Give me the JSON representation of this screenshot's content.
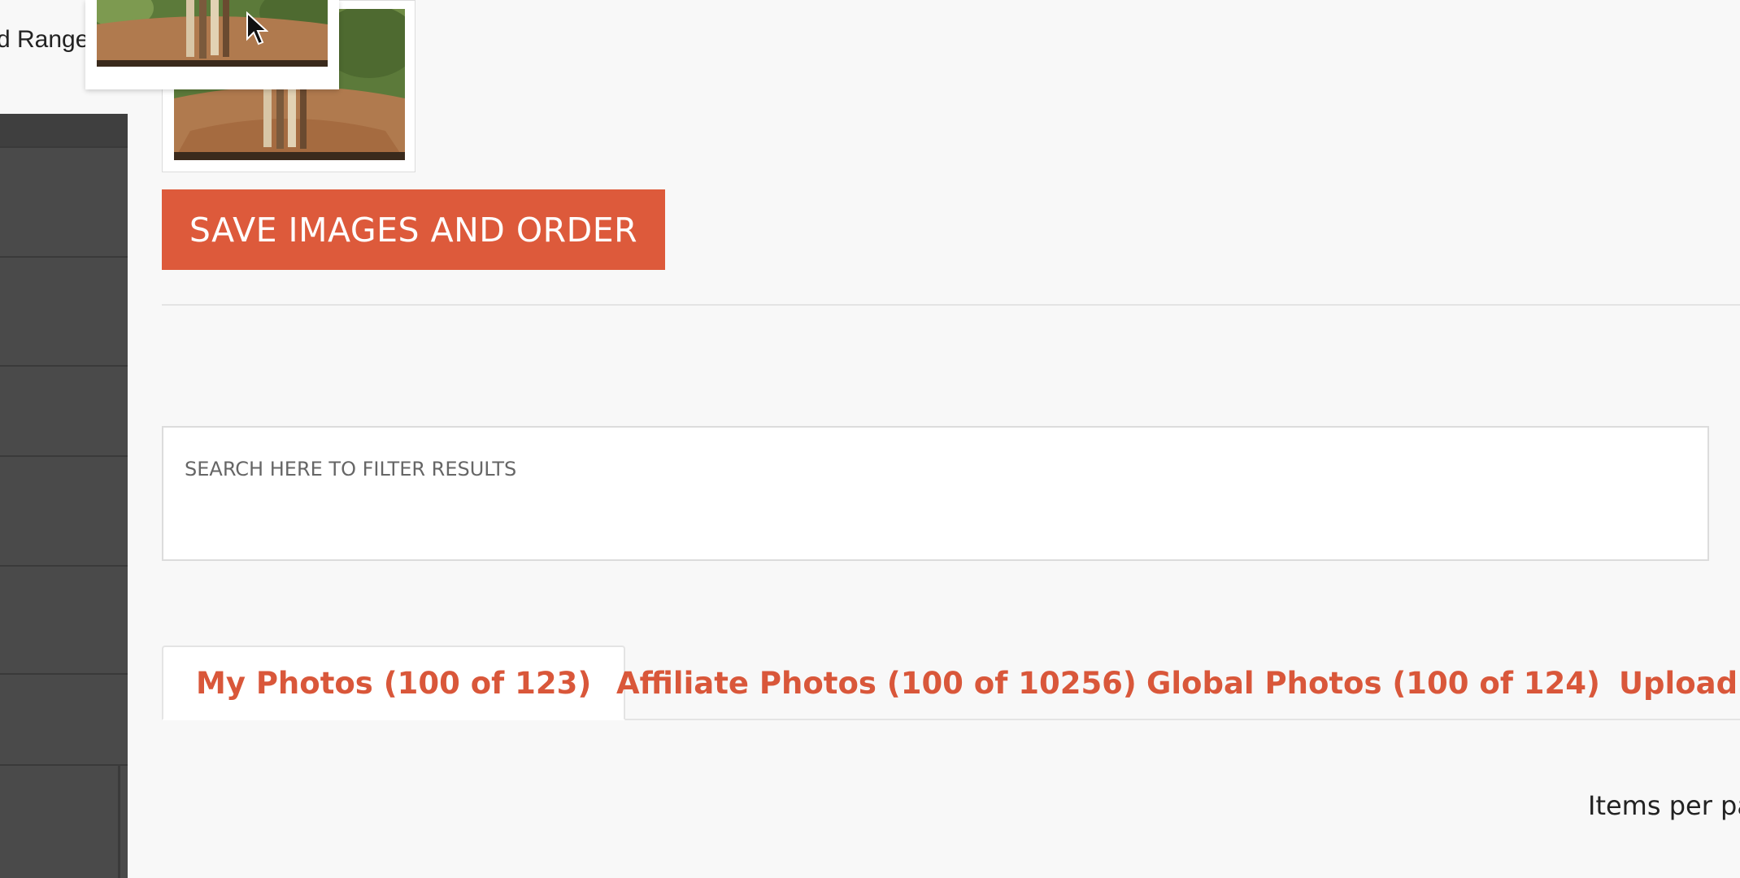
{
  "sidebar": {
    "range_label": "d Range"
  },
  "images": {
    "dragging_name": "drag-preview-thumbnail",
    "static_name": "photo-thumbnail"
  },
  "toolbar": {
    "save_label": "SAVE IMAGES AND ORDER"
  },
  "search": {
    "placeholder": "SEARCH HERE TO FILTER RESULTS",
    "value": ""
  },
  "tabs": [
    {
      "label": "My Photos (100 of 123)",
      "active": true
    },
    {
      "label": "Affiliate Photos (100 of 10256)",
      "active": false
    },
    {
      "label": "Global Photos (100 of 124)",
      "active": false
    },
    {
      "label": "Upload I",
      "active": false
    }
  ],
  "pagination": {
    "items_per_page_label": "Items per pa"
  },
  "colors": {
    "accent": "#dd5a3b",
    "tab_text": "#d9573a",
    "sidebar_bg": "#4a4a4a",
    "page_bg": "#f8f8f8"
  }
}
